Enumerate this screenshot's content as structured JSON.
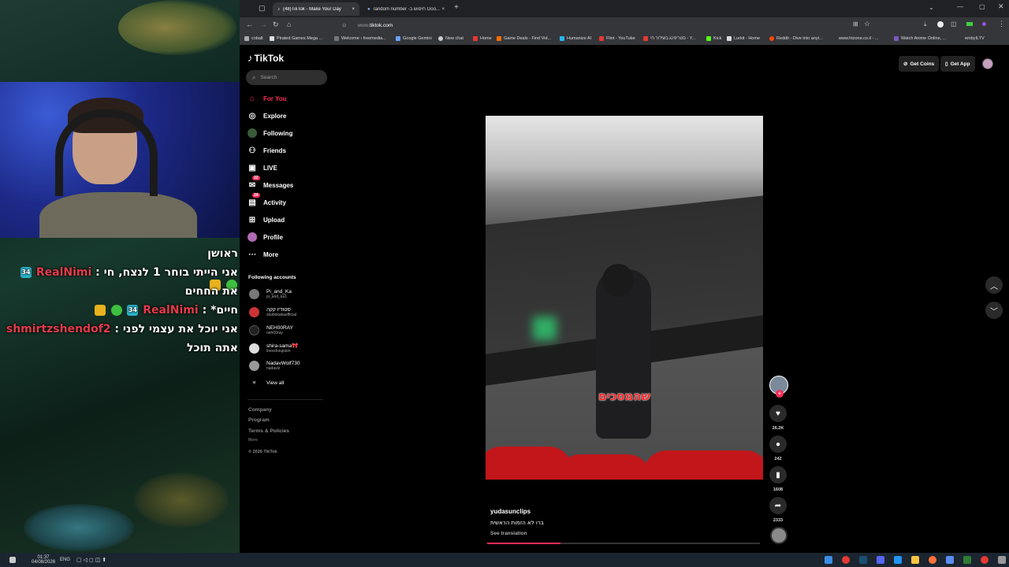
{
  "browser": {
    "tabs": [
      {
        "label": "(48)TikTok - Make Your Day"
      },
      {
        "label": "random number -חיפוש ב Goo..."
      }
    ],
    "url": "tiktok.com",
    "url_prefix": "www.",
    "bookmarks": [
      "cobalt",
      "Pirated Games Mega ...",
      "Welcome › freemedia...",
      "Google Gemini",
      "New chat",
      "Home",
      "Game Deals - Find Vid...",
      "Humanize AI",
      "Flint - YouTube",
      "סטריפינג בשידור חי - Y...",
      "Kick",
      "Lurkit - Home",
      "Reddit - Dive into anyt...",
      "www.htzone.co.il - ...",
      "Watch Anime Online, ...",
      "embyILTV"
    ]
  },
  "tiktok": {
    "logo": "TikTok",
    "search_placeholder": "Search",
    "nav": [
      {
        "label": "For You",
        "icon": "home-icon",
        "active": true
      },
      {
        "label": "Explore",
        "icon": "compass-icon"
      },
      {
        "label": "Following",
        "icon": "following-icon"
      },
      {
        "label": "Friends",
        "icon": "friends-icon"
      },
      {
        "label": "LIVE",
        "icon": "live-icon"
      },
      {
        "label": "Messages",
        "icon": "messages-icon",
        "badge": "22"
      },
      {
        "label": "Activity",
        "icon": "activity-icon",
        "badge": "24"
      },
      {
        "label": "Upload",
        "icon": "upload-icon"
      },
      {
        "label": "Profile",
        "icon": "profile-icon"
      },
      {
        "label": "More",
        "icon": "more-icon"
      }
    ],
    "following_title": "Following accounts",
    "accounts": [
      {
        "name": "Pi_and_Ka",
        "handle": "pi_and_ka1"
      },
      {
        "name": "סטודיו קקה",
        "handle": "studiokakaofficial"
      },
      {
        "name": "NEH00RAY",
        "handle": "neh00ray"
      },
      {
        "name": "shira-sama🎀",
        "handle": "loveshoujosm"
      },
      {
        "name": "NadavWolf730",
        "handle": "nadaviz"
      }
    ],
    "view_all": "View all",
    "footer": [
      "Company",
      "Program",
      "Terms & Policies"
    ],
    "footer_more": "More",
    "copyright": "© 2026 TikTok",
    "get_coins": "Get Coins",
    "get_app": "Get App",
    "video": {
      "subtitle": "שהמסכים",
      "author": "yudasunclips",
      "caption": "ברו לא הזמות הראשית",
      "see_translation": "See translation",
      "likes": "26.2K",
      "comments": "242",
      "saves": "1608",
      "shares": "2333"
    }
  },
  "stream_chat": [
    {
      "text": "ראושן"
    },
    {
      "user": "RealNimi",
      "msg": "אני הייתי בוחר 1 לנצח, חי"
    },
    {
      "text": "את החחים"
    },
    {
      "user": "RealNimi",
      "msg": "חיים*"
    },
    {
      "user": "shmirtzshendof2",
      "msg": "אני יוכל את עצמי לפני"
    },
    {
      "text": "אתה תוכל"
    }
  ],
  "badge_level": "34",
  "taskbar": {
    "time": "01:37",
    "date": "04/08/2026",
    "lang": "ENG"
  }
}
